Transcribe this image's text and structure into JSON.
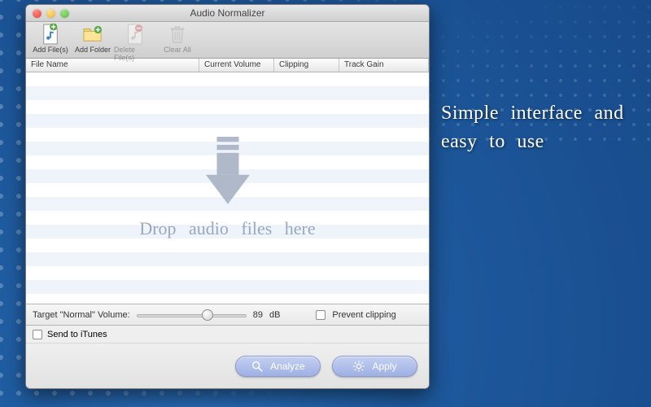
{
  "promo": {
    "text": "Simple interface and easy to use"
  },
  "window": {
    "title": "Audio Normalizer",
    "traffic": {
      "close": "close",
      "minimize": "minimize",
      "zoom": "zoom"
    }
  },
  "toolbar": {
    "items": [
      {
        "label": "Add File(s)",
        "enabled": true
      },
      {
        "label": "Add Folder",
        "enabled": true
      },
      {
        "label": "Delete File(s)",
        "enabled": false
      },
      {
        "label": "Clear All",
        "enabled": false
      }
    ]
  },
  "columns": {
    "c1": "File Name",
    "c2": "Current Volume",
    "c3": "Clipping",
    "c4": "Track Gain"
  },
  "droparea": {
    "text": "Drop audio files here"
  },
  "controls": {
    "target_label": "Target \"Normal\" Volume:",
    "target_value": "89",
    "target_unit": "dB",
    "prevent_clipping_label": "Prevent clipping",
    "prevent_clipping_checked": false,
    "send_itunes_label": "Send to iTunes",
    "send_itunes_checked": false
  },
  "buttons": {
    "analyze": "Analyze",
    "apply": "Apply"
  }
}
